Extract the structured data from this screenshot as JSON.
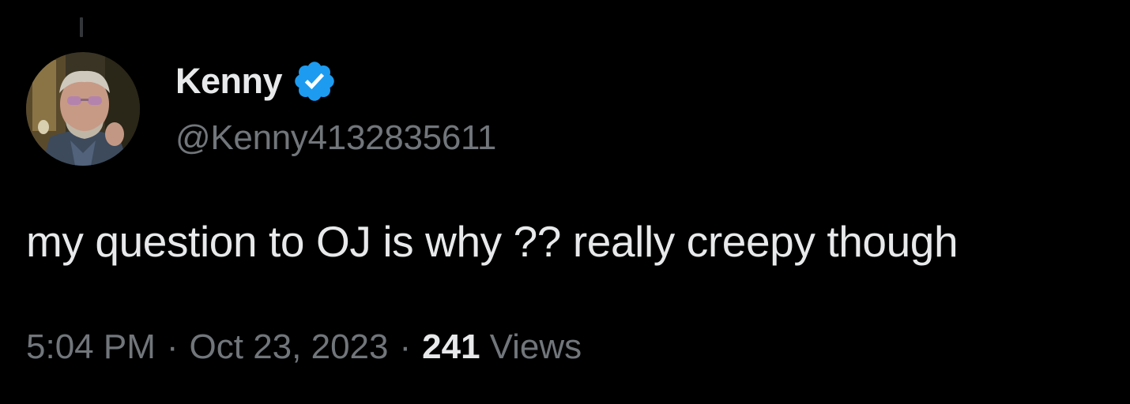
{
  "tweet": {
    "author": {
      "display_name": "Kenny",
      "handle": "@Kenny4132835611",
      "verified": true,
      "verified_color": "#1d9bf0"
    },
    "text": "my question to OJ is why ?? really creepy though",
    "meta": {
      "time": "5:04 PM",
      "separator": "·",
      "date": "Oct 23, 2023",
      "views_count": "241",
      "views_label": "Views"
    }
  },
  "colors": {
    "background": "#000000",
    "primary_text": "#e7e9ea",
    "secondary_text": "#71767b",
    "thread_line": "#333639"
  },
  "icons": {
    "avatar": "profile-photo",
    "badge": "verified-badge-icon"
  }
}
